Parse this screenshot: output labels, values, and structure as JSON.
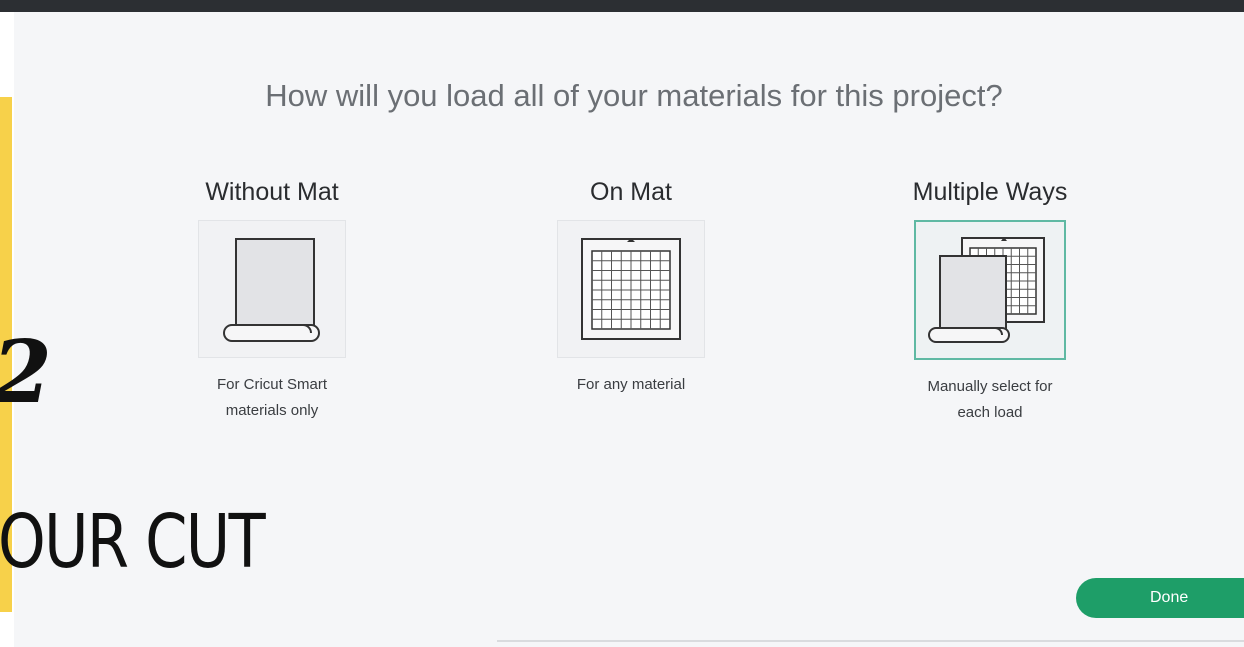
{
  "dialog": {
    "title": "How will you load all of your materials for this project?"
  },
  "options": [
    {
      "title": "Without Mat",
      "description_line1": "For Cricut Smart",
      "description_line2": "materials only",
      "icon": "material-roll-icon",
      "selected": false
    },
    {
      "title": "On Mat",
      "description_line1": "For any material",
      "description_line2": "",
      "icon": "cutting-mat-icon",
      "selected": false
    },
    {
      "title": "Multiple Ways",
      "description_line1": "Manually select for",
      "description_line2": "each load",
      "icon": "mat-and-roll-icon",
      "selected": true
    }
  ],
  "done_button": {
    "label": "Done"
  },
  "overlay": {
    "step_text": "2",
    "cut_text": "OUR CUT"
  },
  "colors": {
    "accent_yellow": "#f7d14a",
    "done_green": "#1e9e68",
    "selected_border": "#5fb9a3",
    "top_bar": "#2c2f33"
  }
}
